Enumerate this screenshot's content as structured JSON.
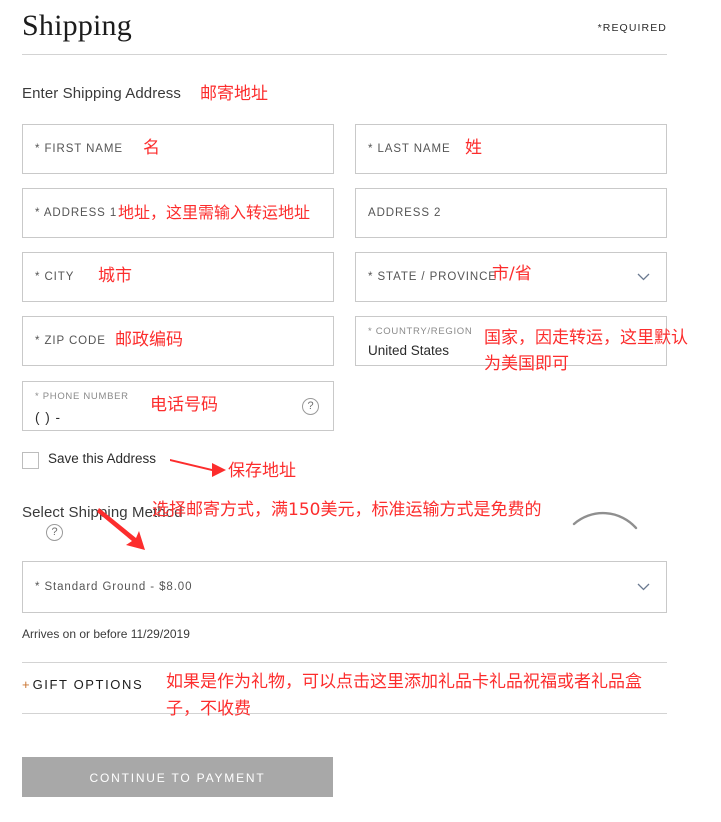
{
  "header": {
    "title": "Shipping",
    "required_note": "*REQUIRED"
  },
  "sections": {
    "enter_shipping_address": "Enter Shipping Address",
    "select_shipping_method": "Select Shipping Method"
  },
  "form": {
    "first_name": {
      "label": "* FIRST NAME",
      "value": ""
    },
    "last_name": {
      "label": "* LAST NAME",
      "value": ""
    },
    "address_1": {
      "label": "* ADDRESS 1",
      "value": ""
    },
    "address_2": {
      "label": "ADDRESS 2",
      "value": ""
    },
    "city": {
      "label": "* CITY",
      "value": ""
    },
    "state": {
      "label": "* STATE / PROVINCE",
      "value": ""
    },
    "zip": {
      "label": "* ZIP CODE",
      "value": ""
    },
    "country": {
      "label": "* COUNTRY/REGION",
      "value": "United States"
    },
    "phone": {
      "label": "* PHONE NUMBER",
      "mask": "(  )  -",
      "help": "?"
    },
    "save_address": {
      "label": "Save this Address",
      "checked": false
    }
  },
  "shipping_method": {
    "help": "?",
    "selected": "* Standard Ground - $8.00",
    "arrival": "Arrives on or before 11/29/2019"
  },
  "gift_options": {
    "plus": "+",
    "label": "GIFT OPTIONS"
  },
  "actions": {
    "continue_to_payment": "CONTINUE TO PAYMENT"
  },
  "annotations": {
    "color": "#fc2d2d",
    "address_heading": "邮寄地址",
    "first_name": "名",
    "last_name": "姓",
    "address_1": "地址，这里需输入转运地址",
    "city": "城市",
    "state": "市/省",
    "zip": "邮政编码",
    "country": "国家，因走转运，这里默认\n为美国即可",
    "phone": "电话号码",
    "save_address": "保存地址",
    "shipping_method": "选择邮寄方式，满150美元，标准运输方式是免费的",
    "gift_options": "如果是作为礼物，可以点击这里添加礼品卡礼品祝福或者礼品盒\n子，不收费"
  }
}
